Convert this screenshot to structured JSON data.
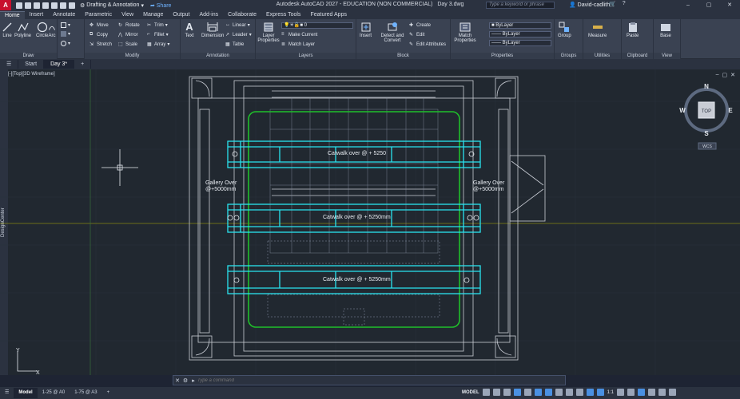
{
  "app": {
    "logo": "A",
    "title": "Autodesk AutoCAD 2027 - EDUCATION (NON COMMERCIAL)",
    "document": "Day 3.dwg",
    "workspace": "Drafting & Annotation",
    "share_label": "Share",
    "search_placeholder": "Type a keyword or phrase",
    "user": "David-cadlith..."
  },
  "ribbon_tabs": [
    "Home",
    "Insert",
    "Annotate",
    "Parametric",
    "View",
    "Manage",
    "Output",
    "Add-ins",
    "Collaborate",
    "Express Tools",
    "Featured Apps"
  ],
  "ribbon": {
    "draw": {
      "title": "Draw",
      "line": "Line",
      "polyline": "Polyline",
      "circle": "Circle",
      "arc": "Arc"
    },
    "modify": {
      "title": "Modify",
      "move": "Move",
      "rotate": "Rotate",
      "trim": "Trim",
      "copy": "Copy",
      "mirror": "Mirror",
      "fillet": "Fillet",
      "stretch": "Stretch",
      "scale": "Scale",
      "array": "Array"
    },
    "annotation": {
      "title": "Annotation",
      "text": "Text",
      "dimension": "Dimension",
      "linear": "Linear",
      "leader": "Leader",
      "table": "Table"
    },
    "layers": {
      "title": "Layers",
      "layer_properties": "Layer Properties",
      "current_layer": "0",
      "make_current": "Make Current",
      "match_layer": "Match Layer"
    },
    "block": {
      "title": "Block",
      "insert": "Insert",
      "detect_convert": "Detect and Convert",
      "create": "Create",
      "edit": "Edit",
      "edit_attributes": "Edit Attributes"
    },
    "properties": {
      "title": "Properties",
      "match": "Match Properties",
      "color": "ByLayer",
      "linetype": "ByLayer",
      "lineweight": "ByLayer"
    },
    "groups": {
      "title": "Groups",
      "group": "Group"
    },
    "utilities": {
      "title": "Utilities",
      "measure": "Measure"
    },
    "clipboard": {
      "title": "Clipboard",
      "paste": "Paste"
    },
    "view": {
      "title": "View",
      "base": "Base"
    }
  },
  "file_tabs": [
    "Start",
    "Day 3*"
  ],
  "viewport": {
    "label": "[-][Top][3D Wireframe]",
    "side_panel": "DesignCenter",
    "viewcube": {
      "n": "N",
      "s": "S",
      "e": "E",
      "w": "W",
      "face": "TOP",
      "wcs": "WCS"
    }
  },
  "drawing_labels": {
    "catwalk1": "Catwalk over @ + 5250",
    "catwalk2": "Catwalk over @ + 5250mm",
    "catwalk3": "Catwalk over @ + 5250mm",
    "gallery_left_1": "Gallery Over",
    "gallery_left_2": "@+5000mm",
    "gallery_right_1": "Gallery Over",
    "gallery_right_2": "@+5000mm"
  },
  "colors": {
    "catwalk": "#29e3ef",
    "stage": "#1fbf2a",
    "linework": "#c8ccd4",
    "axis_x": "#c8102e",
    "axis_y": "#b3b300"
  },
  "command": {
    "placeholder": "Type a command"
  },
  "layout_tabs": [
    "Model",
    "1-25 @ A0",
    "1-75 @ A3"
  ],
  "status": {
    "model": "MODEL",
    "scale": "1:1"
  }
}
